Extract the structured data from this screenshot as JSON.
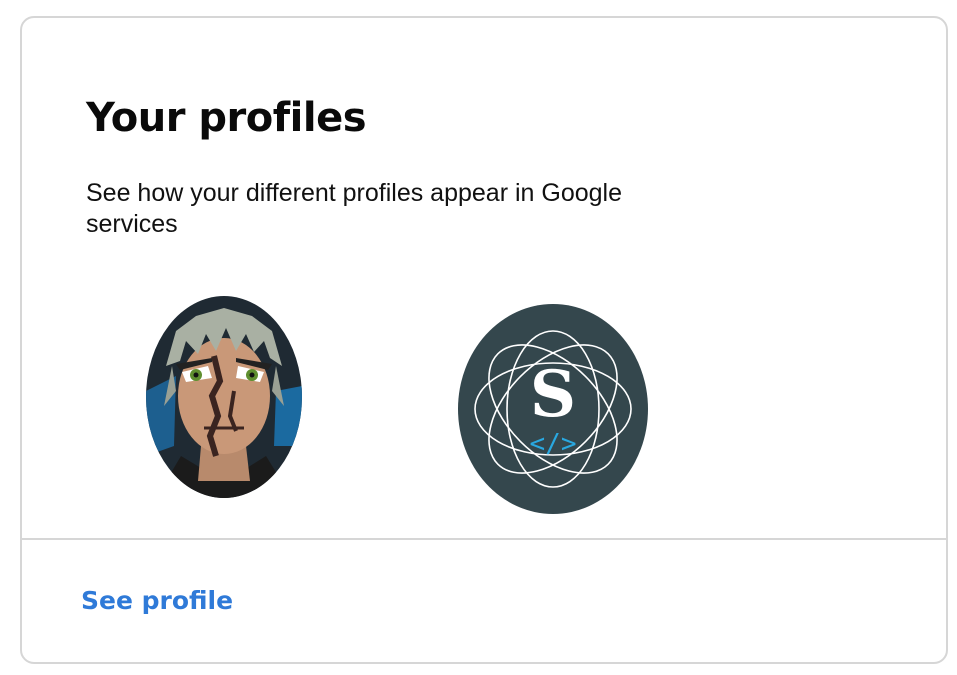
{
  "card": {
    "title": "Your profiles",
    "description": "See how your different profiles appear in Google services",
    "link_label": "See profile"
  },
  "avatars": [
    {
      "icon": "anime-character-avatar-icon"
    },
    {
      "icon": "s-code-logo-avatar-icon",
      "letter": "S",
      "code_glyph": "</>"
    }
  ],
  "colors": {
    "link": "#2f7ad8",
    "border": "#d6d6d6",
    "logo_bg": "#34474d",
    "logo_code": "#29a8e0"
  }
}
